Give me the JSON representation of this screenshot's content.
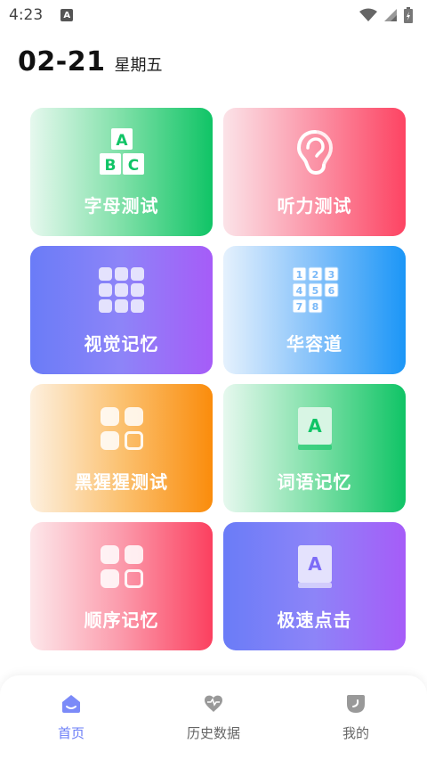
{
  "status_bar": {
    "time": "4:23",
    "notification_letter": "A"
  },
  "header": {
    "date": "02-21",
    "weekday": "星期五"
  },
  "cards": [
    {
      "label": "字母测试",
      "icon": "abc-blocks-icon"
    },
    {
      "label": "听力测试",
      "icon": "ear-icon"
    },
    {
      "label": "视觉记忆",
      "icon": "dot-grid-icon"
    },
    {
      "label": "华容道",
      "icon": "number-grid-icon"
    },
    {
      "label": "黑猩猩测试",
      "icon": "four-squares-icon"
    },
    {
      "label": "词语记忆",
      "icon": "book-a-icon"
    },
    {
      "label": "顺序记忆",
      "icon": "four-squares-icon"
    },
    {
      "label": "极速点击",
      "icon": "book-a-icon"
    }
  ],
  "abc_letters": [
    "A",
    "B",
    "C"
  ],
  "number_grid": [
    "1",
    "2",
    "3",
    "4",
    "5",
    "6",
    "7",
    "8"
  ],
  "book_letter": "A",
  "bottom_nav": [
    {
      "label": "首页",
      "icon": "home-icon",
      "active": true
    },
    {
      "label": "历史数据",
      "icon": "history-icon",
      "active": false
    },
    {
      "label": "我的",
      "icon": "profile-icon",
      "active": false
    }
  ],
  "colors": {
    "accent": "#6a7cf7",
    "nav_inactive": "#666666"
  }
}
